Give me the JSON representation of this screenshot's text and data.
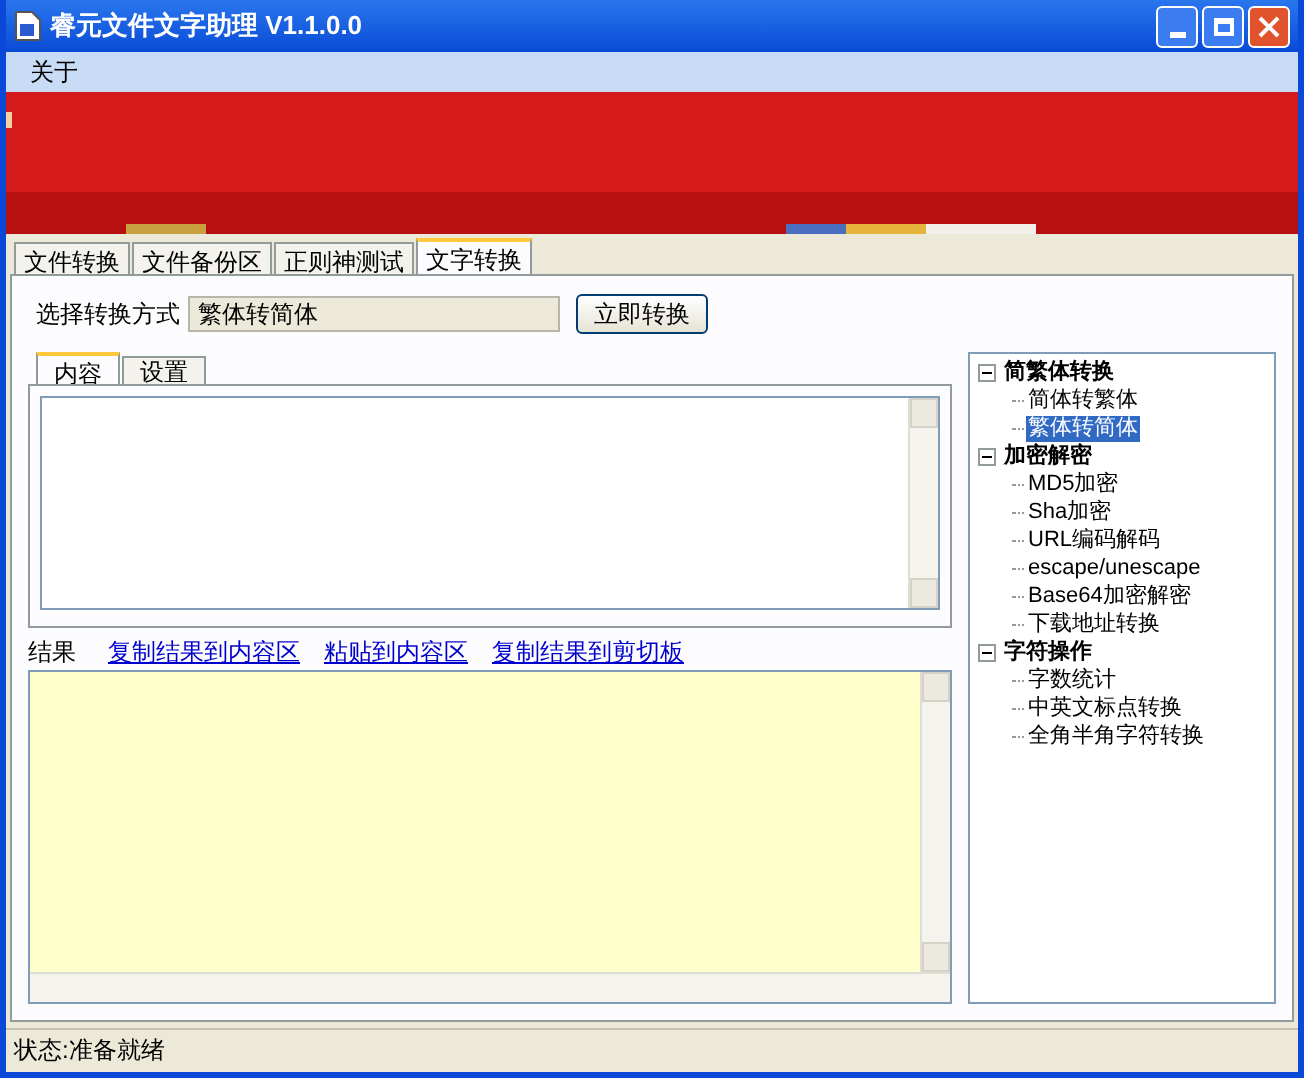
{
  "window": {
    "title": "睿元文件文字助理 V1.1.0.0"
  },
  "menu": [
    "关于"
  ],
  "banner": {
    "kind": "picture"
  },
  "tabs": [
    {
      "label": "文件转换",
      "selected": false
    },
    {
      "label": "文件备份区",
      "selected": false
    },
    {
      "label": "正则神测试",
      "selected": false
    },
    {
      "label": "文字转换",
      "selected": true
    }
  ],
  "mode": {
    "label": "选择转换方式",
    "value": "繁体转简体",
    "button": "立即转换"
  },
  "inner_tabs": [
    {
      "label": "内容",
      "selected": true
    },
    {
      "label": "设置",
      "selected": false
    }
  ],
  "result": {
    "label": "结果",
    "links": [
      "复制结果到内容区",
      "粘贴到内容区",
      "复制结果到剪切板"
    ]
  },
  "tree": [
    {
      "label": "简繁体转换",
      "expanded": true,
      "children": [
        {
          "label": "简体转繁体",
          "selected": false
        },
        {
          "label": "繁体转简体",
          "selected": true
        }
      ]
    },
    {
      "label": "加密解密",
      "expanded": true,
      "children": [
        {
          "label": "MD5加密",
          "selected": false
        },
        {
          "label": "Sha加密",
          "selected": false
        },
        {
          "label": "URL编码解码",
          "selected": false
        },
        {
          "label": "escape/unescape",
          "selected": false
        },
        {
          "label": "Base64加密解密",
          "selected": false
        },
        {
          "label": "下载地址转换",
          "selected": false
        }
      ]
    },
    {
      "label": "字符操作",
      "expanded": true,
      "children": [
        {
          "label": "字数统计",
          "selected": false
        },
        {
          "label": "中英文标点转换",
          "selected": false
        },
        {
          "label": "全角半角字符转换",
          "selected": false
        }
      ]
    }
  ],
  "status_bar": "状态:准备就绪"
}
